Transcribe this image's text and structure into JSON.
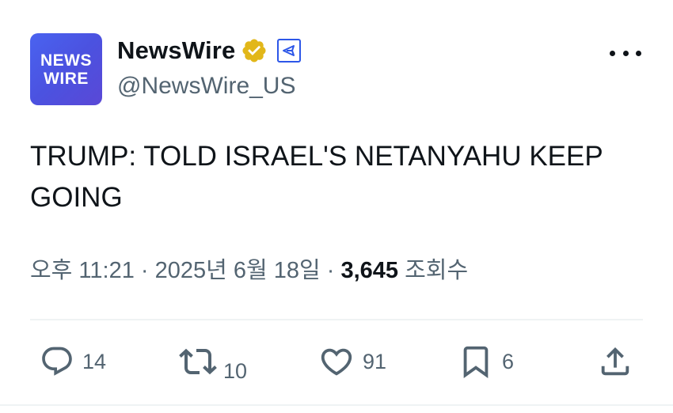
{
  "account": {
    "avatar_line1": "NEWS",
    "avatar_line2": "WIRE",
    "display_name": "NewsWire",
    "handle": "@NewsWire_US",
    "verified_icon": "gold-check-badge-icon",
    "affiliation_icon": "affiliate-badge-icon"
  },
  "menu": {
    "icon": "more-horizontal-icon"
  },
  "tweet": {
    "text": "TRUMP: TOLD ISRAEL'S NETANYAHU KEEP GOING"
  },
  "meta": {
    "time": "오후 11:21",
    "separator1": " · ",
    "date": "2025년 6월 18일",
    "separator2": " · ",
    "views": "3,645",
    "views_label": " 조회수"
  },
  "actions": {
    "reply": {
      "icon": "reply-icon",
      "count": "14"
    },
    "retweet": {
      "icon": "retweet-icon",
      "count": "10"
    },
    "like": {
      "icon": "heart-icon",
      "count": "91"
    },
    "bookmark": {
      "icon": "bookmark-icon",
      "count": "6"
    },
    "share": {
      "icon": "share-icon"
    }
  },
  "colors": {
    "text": "#0f1419",
    "secondary": "#536471",
    "avatar_bg": "#4b52e0",
    "verified_gold": "#e2b719",
    "affiliate_blue": "#2d57e8",
    "divider": "#eff3f4"
  }
}
